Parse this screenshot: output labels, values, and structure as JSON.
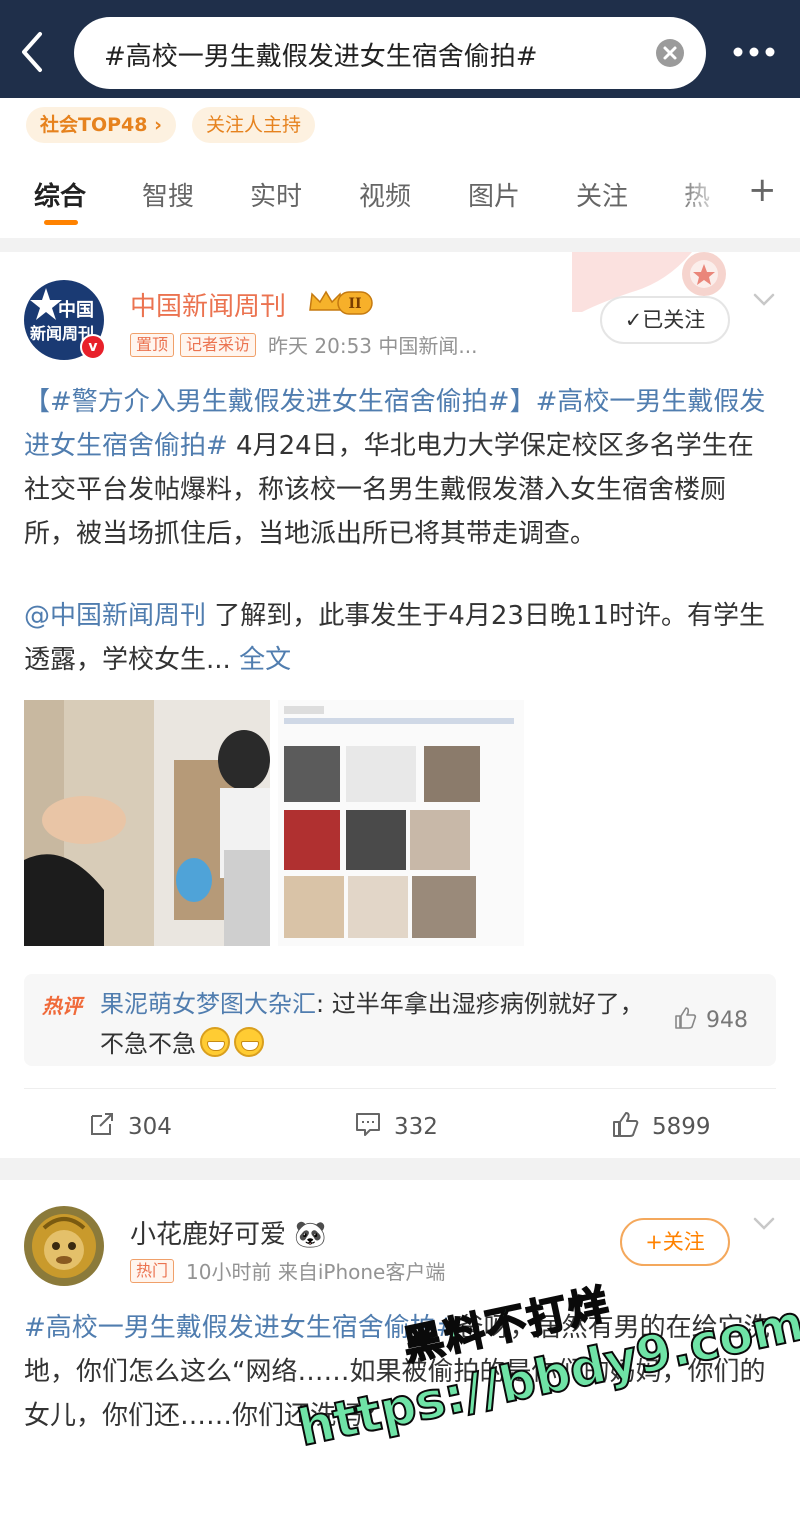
{
  "header": {
    "search_query": "#高校一男生戴假发进女生宿舍偷拍#"
  },
  "subbar": {
    "pill_rank": "社会TOP48 ›",
    "pill_host": "关注人主持"
  },
  "tabs": [
    {
      "label": "综合"
    },
    {
      "label": "智搜"
    },
    {
      "label": "实时"
    },
    {
      "label": "视频"
    },
    {
      "label": "图片"
    },
    {
      "label": "关注"
    },
    {
      "label": "热"
    }
  ],
  "tab_plus": "+",
  "post1": {
    "author": "中国新闻周刊",
    "avatar_line1": "中国",
    "avatar_line2": "新闻周刊",
    "verified": "v",
    "tags": [
      "置顶",
      "记者采访"
    ],
    "meta": "昨天 20:53  中国新闻...",
    "follow_label": "✓已关注",
    "text": {
      "p1_hashtag": "【#警方介入男生戴假发进女生宿舍偷拍#】#高校一男生戴假发进女生宿舍偷拍#",
      "p1_rest": " 4月24日，华北电力大学保定校区多名学生在社交平台发帖爆料，称该校一名男生戴假发潜入女生宿舍楼厕所，被当场抓住后，当地派出所已将其带走调查。",
      "p2_mention": "@中国新闻周刊",
      "p2_rest": " 了解到，此事发生于4月23日晚11时许。有学生透露，学校女生... ",
      "more": "全文"
    },
    "hot_comment": {
      "badge": "热评",
      "user": "果泥萌女梦图大杂汇",
      "text": ": 过半年拿出湿疹病例就好了，不急不急",
      "likes": "948"
    },
    "actions": {
      "reposts": "304",
      "comments": "332",
      "likes": "5899"
    }
  },
  "post2": {
    "author": "小花鹿好可爱",
    "author_emoji": "🐼",
    "tags": [
      "热门"
    ],
    "meta": "10小时前  来自iPhone客户端",
    "follow_label": "+关注",
    "text": {
      "hashtag": "#高校一男生戴假发进女生宿舍偷拍#",
      "rest": "爸呀，居然有男的在给它洗地，你们怎么这么“网络……如果被偷拍的是你们的妈妈，你们的女儿，你们还……你们还洗吗?"
    }
  },
  "watermark": {
    "line1": "黑料不打烊",
    "line2": "https://bbdy9.com"
  },
  "colors": {
    "header_bg": "#1f2f4a",
    "accent": "#ff8200",
    "link": "#507daf",
    "name_orange": "#eb7350"
  }
}
